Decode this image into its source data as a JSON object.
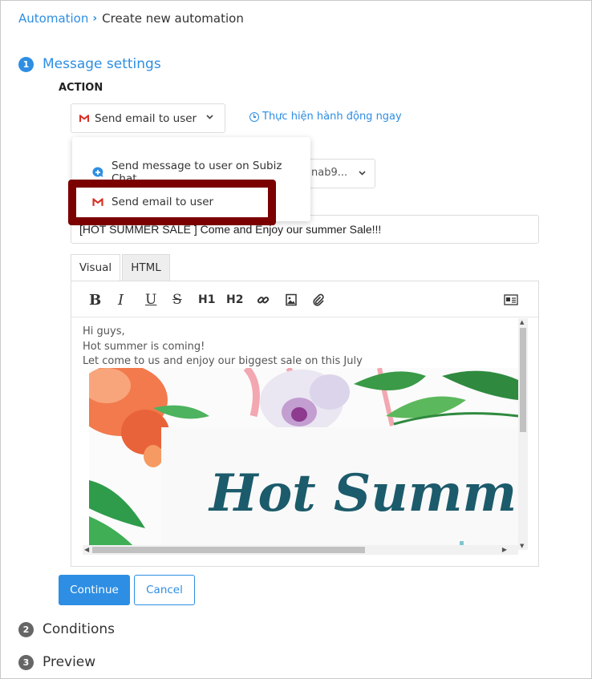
{
  "breadcrumb": {
    "root": "Automation",
    "separator": "›",
    "current": "Create new automation"
  },
  "steps": [
    {
      "number": "1",
      "title": "Message settings"
    },
    {
      "number": "2",
      "title": "Conditions"
    },
    {
      "number": "3",
      "title": "Preview"
    }
  ],
  "action": {
    "label": "ACTION",
    "selected": "Send email to user",
    "now_link": "Thực hiện hành động ngay"
  },
  "sender": {
    "value": "nab9..."
  },
  "subject": {
    "value": "[HOT SUMMER SALE ] Come and Enjoy our summer Sale!!!"
  },
  "tabs": [
    {
      "label": "Visual"
    },
    {
      "label": "HTML"
    }
  ],
  "toolbar": {
    "bold": "B",
    "italic": "I",
    "underline": "U",
    "strike": "S",
    "h1": "H1",
    "h2": "H2"
  },
  "content": {
    "lines": [
      "Hi guys,",
      "Hot summer is coming!",
      "Let come to us and enjoy our biggest sale on this July"
    ],
    "banner_text": "Hot Summer S"
  },
  "dropdown": {
    "items": [
      {
        "label": "Send message to user on Subiz Chat",
        "icon": "subiz-chat-icon"
      },
      {
        "label": "Send email to user",
        "icon": "gmail-icon"
      }
    ]
  },
  "buttons": {
    "continue": "Continue",
    "cancel": "Cancel"
  },
  "colors": {
    "accent": "#2d8ee3",
    "highlight": "#7b0000",
    "banner_text": "#1c5b6b"
  }
}
